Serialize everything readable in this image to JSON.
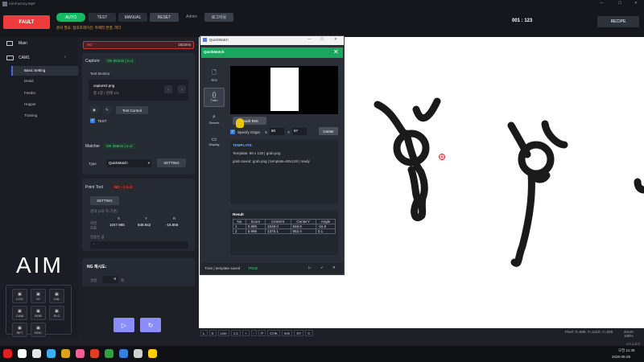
{
  "titlebar": {
    "title": "AimFactory.WpF"
  },
  "topbar": {
    "fault": "FAULT",
    "auto": "AUTO",
    "test": "TEST",
    "manual": "MANUAL",
    "reset": "RESET",
    "user": "Admin",
    "logout": "로그아웃",
    "status": "준비 필요: 협의포레이션, 카메라 연결, 피다",
    "counter": "001 : 123",
    "recipe": "RECIPE"
  },
  "sidebar": {
    "main": "Main",
    "cam": "CAM1",
    "items": [
      "Basic Setting",
      "Detail",
      "Feeder",
      "Hopper",
      "Training"
    ],
    "logo": "AIM",
    "tools": [
      "LOG",
      "IO",
      "CAL",
      "CAM",
      "ROB",
      "PLC",
      "SET",
      "DOC"
    ]
  },
  "panel": {
    "ng": {
      "label": "NG",
      "value": "1823ms"
    },
    "capture": {
      "label": "Capture",
      "badge": "OK 551ms | n=1"
    },
    "test_monitor": {
      "label": "Test Monitor",
      "file": "capture2.png",
      "count": "총 1장 / 현재 1/1",
      "test_control": "Test Control",
      "test_check": "TEST"
    },
    "matcher": {
      "label": "Matcher",
      "badge": "OK 358ms | n=2",
      "type_label": "Type",
      "type_value": "QuickMatch",
      "setting": "SETTING"
    },
    "point_tool": {
      "label": "Point Tool",
      "badge": "NG -- | n=1",
      "setting": "SETTING",
      "result_label": "결과 (1의 자 기준)",
      "x_head": "X",
      "y_head": "Y",
      "r_head": "R",
      "row_label": "비전\n좌표",
      "x": "1047.985",
      "y": "848.942",
      "r": "-16.856",
      "transfer_label": "전송된 값",
      "transfer": "-"
    },
    "ng_retry": {
      "label": "NG 재시도:",
      "setting_label": "설정",
      "value": "0",
      "unit": "회"
    }
  },
  "quickmatch": {
    "title": "QuickMatch",
    "header": "QuickMatch",
    "side": [
      "ROI",
      "Train",
      "Search",
      "Display"
    ],
    "teach_roi": "Teach ROI",
    "specify_origin": "Specify Origin",
    "ox_label": "X",
    "ox": "80",
    "oy_label": "Y",
    "oy": "87",
    "center": "Center",
    "template_title": "TEMPLATE",
    "template_line": "Template: 80 x 128 | grab.png",
    "grab_line": "grab saved: grab.png | template=80x128 | ready",
    "result_title": "Result",
    "columns": [
      "No",
      "Score",
      "CenterX",
      "CenterY",
      "Angle"
    ],
    "rows": [
      [
        "1",
        "0.995",
        "1048.0",
        "848.9",
        "-16.9"
      ],
      [
        "2",
        "0.995",
        "1375.1",
        "953.4",
        "0.1"
      ]
    ],
    "status": "Train | template saved",
    "status_flag": "TRUE"
  },
  "viewer": {
    "toolbar": [
      "L",
      "S",
      "Live",
      "1:1",
      "+",
      "-",
      "P",
      "CHK",
      "mm",
      "XY",
      "C"
    ],
    "pixel": "Pixel: X=589, Y=1210, V=255",
    "zoom": "Zoom: 106%"
  },
  "version": "v.0.1.0.0",
  "taskbar": {
    "time": "오전 11:38",
    "date": "2026-05-28"
  }
}
